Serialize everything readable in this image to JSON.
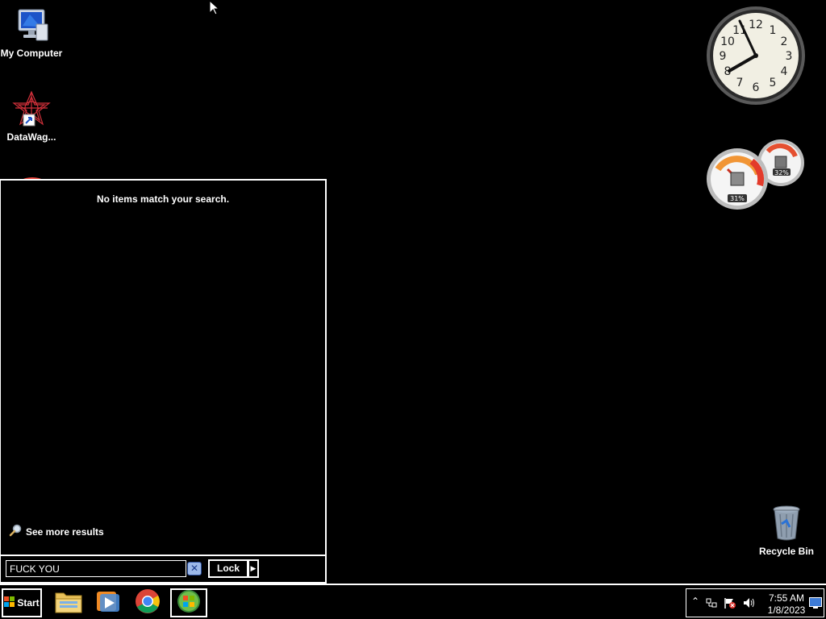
{
  "desktop": {
    "icons": [
      {
        "label": "My Computer"
      },
      {
        "label": "DataWag..."
      },
      {
        "label": "Recycle Bin"
      }
    ]
  },
  "gadgets": {
    "clock": {
      "numbers": [
        "12",
        "1",
        "2",
        "3",
        "4",
        "5",
        "6",
        "7",
        "8",
        "9",
        "10",
        "11"
      ]
    },
    "cpu_meter": {
      "cpu": "31%",
      "memory": "32%"
    }
  },
  "start_menu": {
    "no_items_text": "No items match your search.",
    "see_more_label": "See more results",
    "search": {
      "value": "FUCK YOU"
    },
    "lock_label": "Lock"
  },
  "taskbar": {
    "start_label": "Start",
    "apps": [
      {
        "icon": "windows-explorer-icon"
      },
      {
        "icon": "media-player-icon"
      },
      {
        "icon": "chrome-icon"
      },
      {
        "icon": "windows-logo-icon"
      }
    ],
    "tray": {
      "time": "7:55 AM",
      "date": "1/8/2023"
    }
  }
}
